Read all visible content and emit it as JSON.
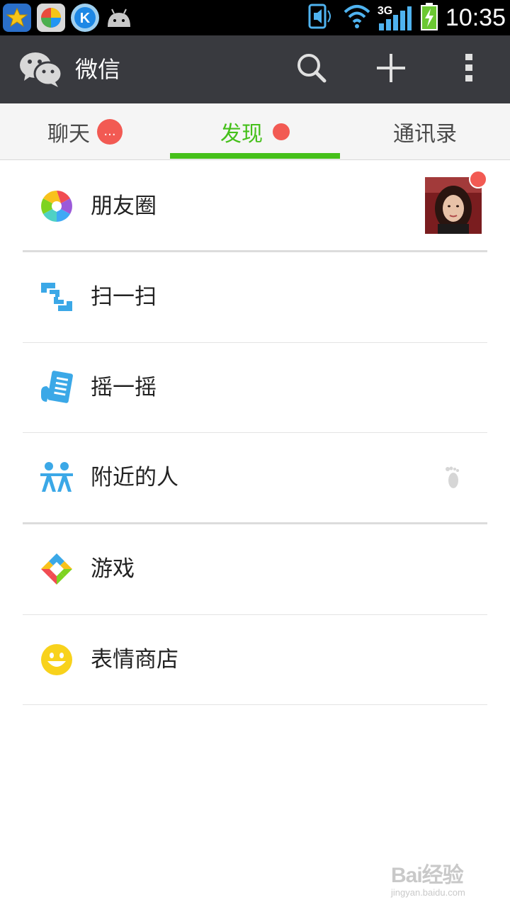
{
  "status_bar": {
    "time": "10:35",
    "network": "3G",
    "notification_icons": [
      "star-app-icon",
      "colorful-app-icon",
      "k-app-icon",
      "android-icon"
    ]
  },
  "header": {
    "title": "微信",
    "icons": [
      "wechat-logo-icon",
      "search-icon",
      "plus-icon",
      "overflow-menu-icon"
    ]
  },
  "tabs": [
    {
      "label": "聊天",
      "badge": "..."
    },
    {
      "label": "发现",
      "active": true
    },
    {
      "label": "通讯录"
    }
  ],
  "discover": {
    "items": [
      {
        "label": "朋友圈",
        "icon": "moments-aperture-icon"
      },
      {
        "label": "扫一扫",
        "icon": "scan-icon"
      },
      {
        "label": "摇一摇",
        "icon": "shake-icon"
      },
      {
        "label": "附近的人",
        "icon": "people-nearby-icon"
      },
      {
        "label": "游戏",
        "icon": "games-icon"
      },
      {
        "label": "表情商店",
        "icon": "sticker-smiley-icon"
      }
    ]
  },
  "colors": {
    "accent": "#45c01a",
    "header_bg": "#393a3f",
    "badge_red": "#f25a53",
    "icon_blue": "#3ba8e7"
  },
  "watermark": {
    "brand": "Bai经验",
    "url": "jingyan.baidu.com"
  }
}
